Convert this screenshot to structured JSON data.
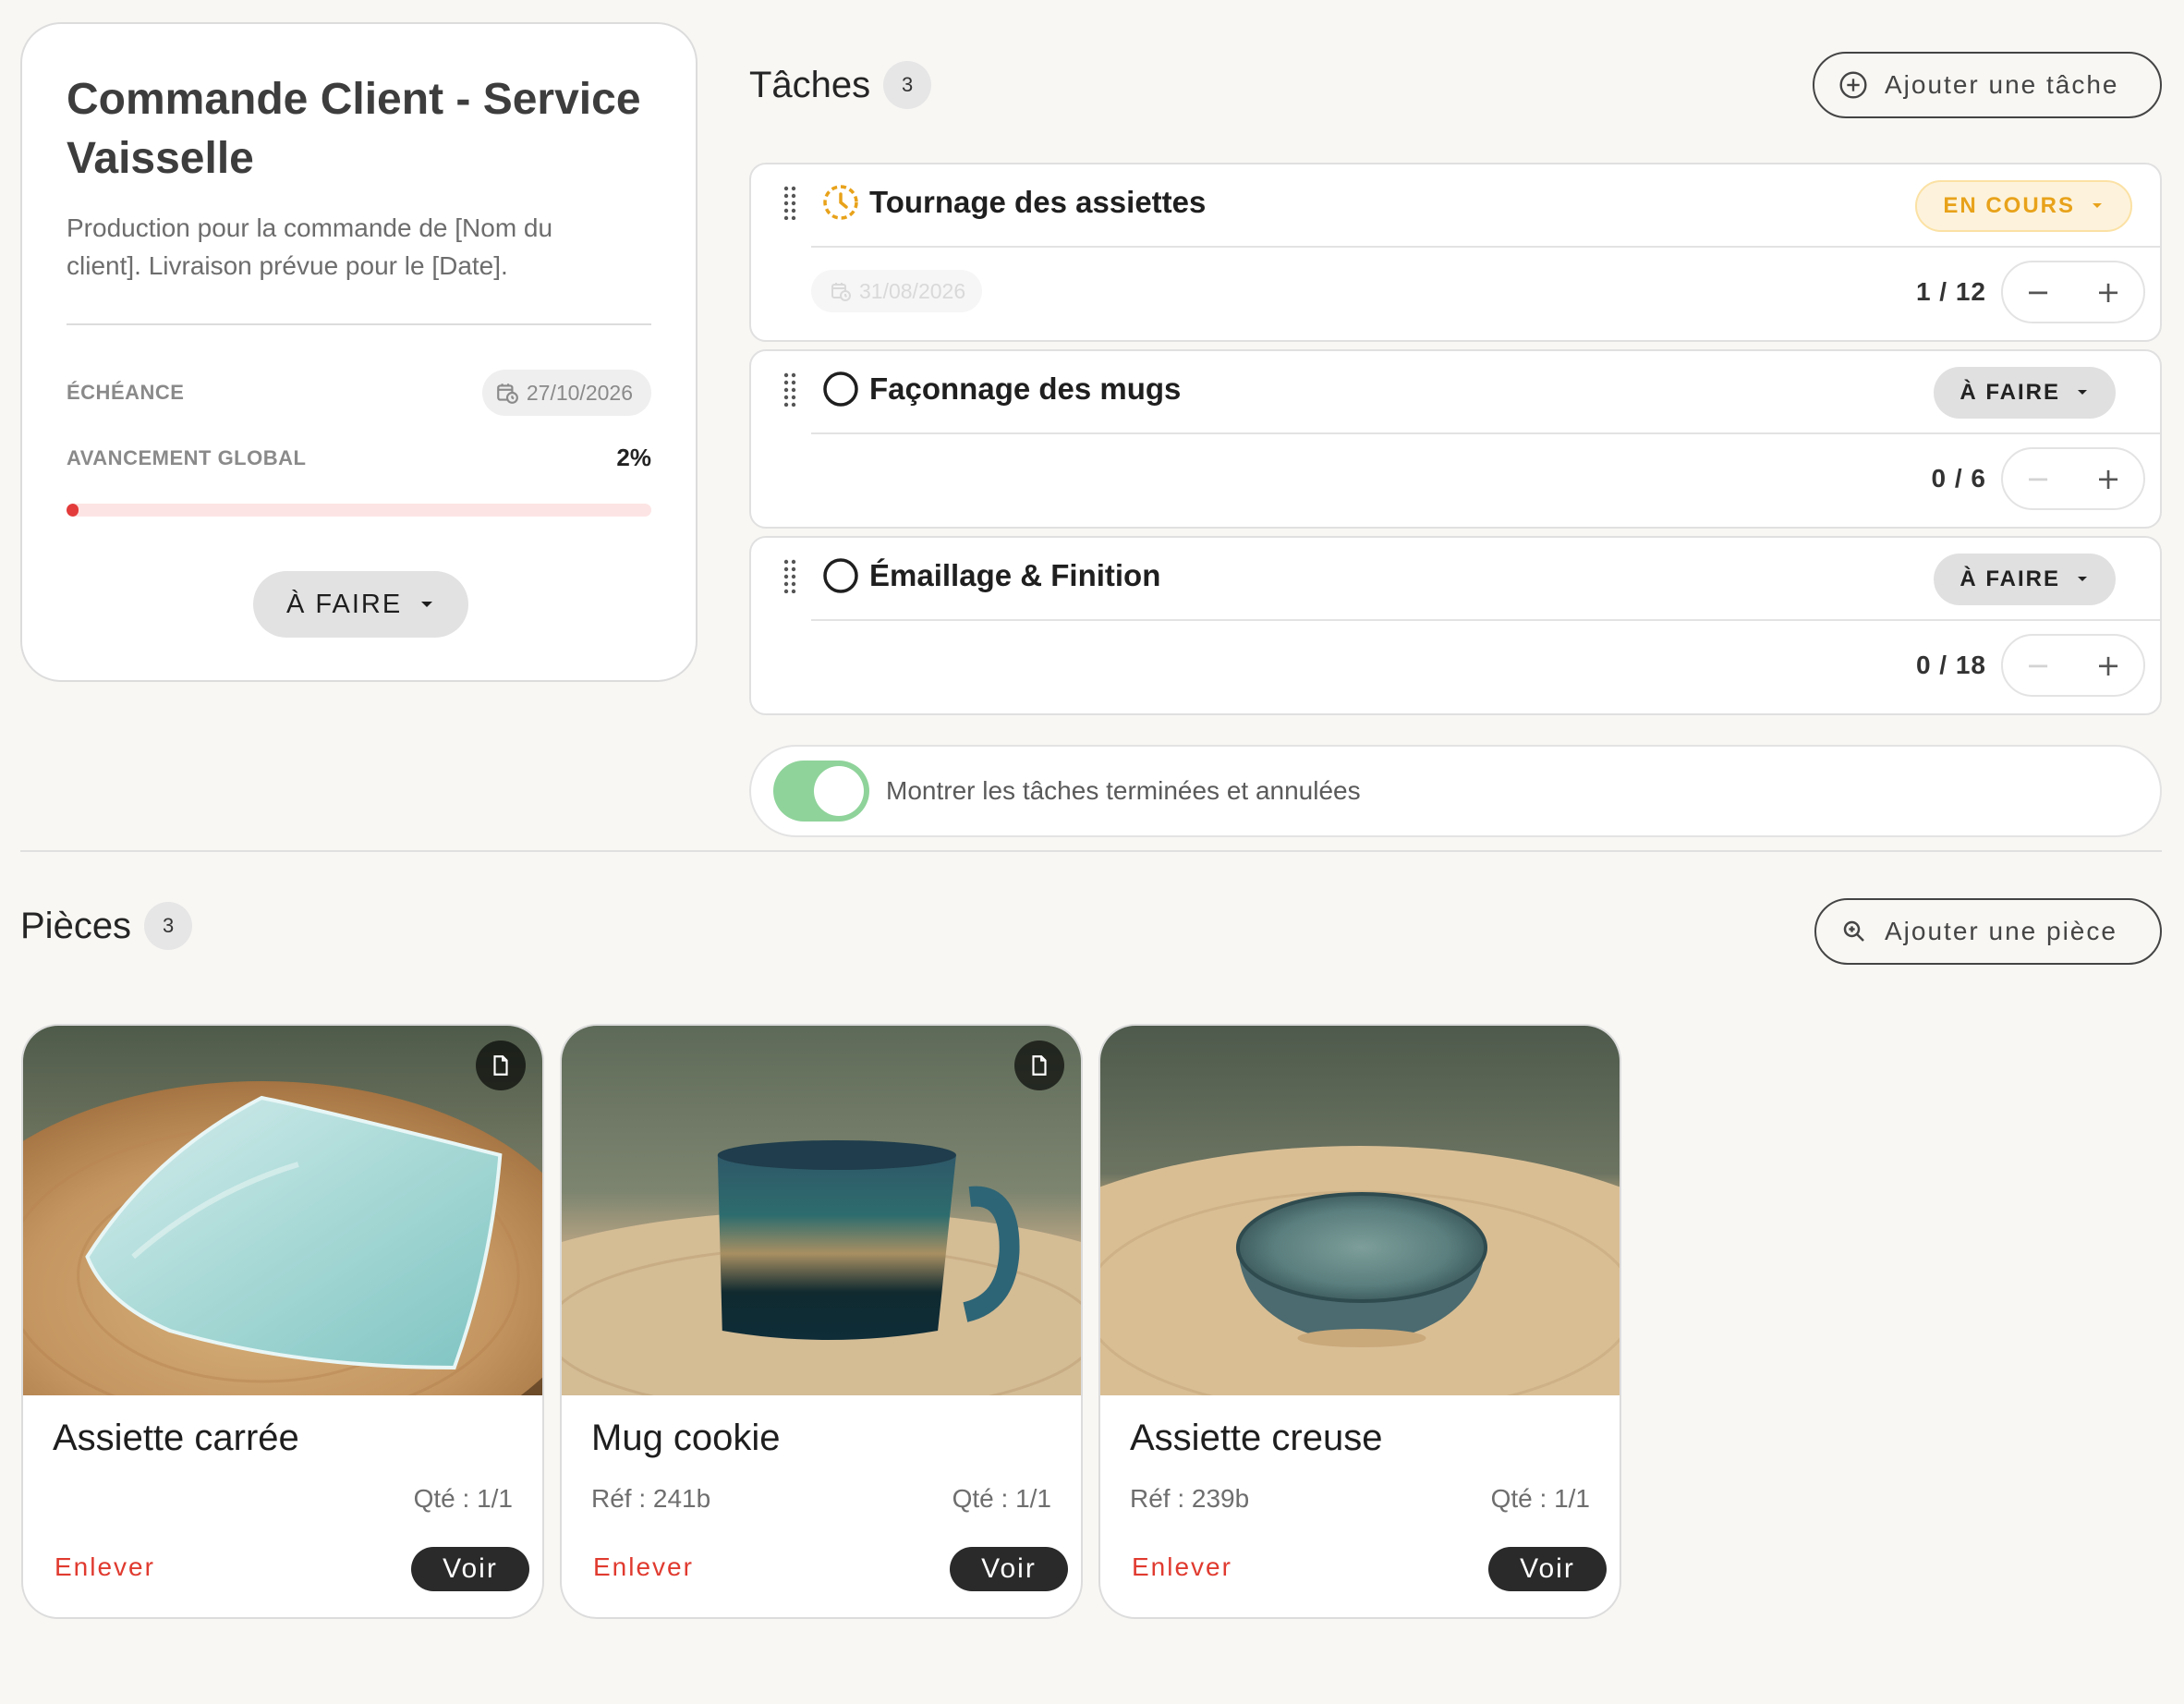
{
  "project": {
    "title": "Commande Client - Service Vaisselle",
    "description": "Production pour la commande de [Nom du client]. Livraison prévue pour le [Date].",
    "deadline_label": "ÉCHÉANCE",
    "deadline_value": "27/10/2026",
    "progress_label": "AVANCEMENT GLOBAL",
    "progress_value": "2%",
    "progress_fraction": 0.02,
    "status": "À FAIRE"
  },
  "tasks": {
    "title": "Tâches",
    "count": "3",
    "add_label": "Ajouter une tâche",
    "items": [
      {
        "title": "Tournage des assiettes",
        "status": "EN COURS",
        "date": "31/08/2026",
        "counter": "1 / 12",
        "minus": "−",
        "plus": "+"
      },
      {
        "title": "Façonnage des mugs",
        "status": "À FAIRE",
        "counter": "0 / 6",
        "minus": "−",
        "plus": "+"
      },
      {
        "title": "Émaillage & Finition",
        "status": "À FAIRE",
        "counter": "0 / 18",
        "minus": "−",
        "plus": "+"
      }
    ],
    "toggle_label": "Montrer les tâches terminées et annulées",
    "toggle_on": true
  },
  "pieces": {
    "title": "Pièces",
    "count": "3",
    "add_label": "Ajouter une pièce",
    "items": [
      {
        "name": "Assiette carrée",
        "ref": "",
        "qty": "Qté : 1/1",
        "remove": "Enlever",
        "view": "Voir"
      },
      {
        "name": "Mug cookie",
        "ref": "Réf : 241b",
        "qty": "Qté : 1/1",
        "remove": "Enlever",
        "view": "Voir"
      },
      {
        "name": "Assiette creuse",
        "ref": "Réf : 239b",
        "qty": "Qté : 1/1",
        "remove": "Enlever",
        "view": "Voir"
      }
    ]
  },
  "colors": {
    "accent_in_progress": "#e8a21a",
    "progress_fill": "#e33b3b",
    "remove_text": "#e03a2f",
    "toggle_on": "#8fd39a"
  }
}
